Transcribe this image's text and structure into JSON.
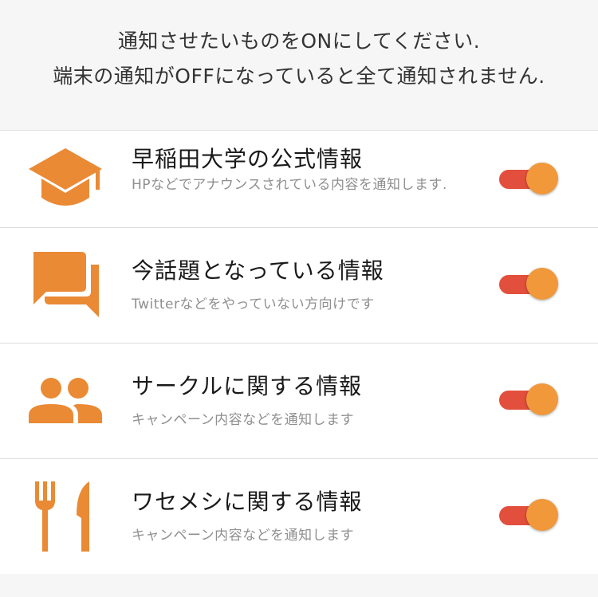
{
  "header": {
    "line1": "通知させたいものをONにしてください.",
    "line2": "端末の通知がOFFになっていると全て通知されません."
  },
  "colors": {
    "accent": "#ea8a35",
    "toggle_track": "#e34f3d",
    "toggle_knob": "#f0983a"
  },
  "items": [
    {
      "icon": "graduation-cap-icon",
      "title": "早稲田大学の公式情報",
      "description": "HPなどでアナウンスされている内容を通知します.",
      "enabled": true
    },
    {
      "icon": "chat-bubbles-icon",
      "title": "今話題となっている情報",
      "description": "Twitterなどをやっていない方向けです",
      "enabled": true
    },
    {
      "icon": "group-icon",
      "title": "サークルに関する情報",
      "description": "キャンペーン内容などを通知します",
      "enabled": true
    },
    {
      "icon": "fork-knife-icon",
      "title": "ワセメシに関する情報",
      "description": "キャンペーン内容などを通知します",
      "enabled": true
    }
  ]
}
